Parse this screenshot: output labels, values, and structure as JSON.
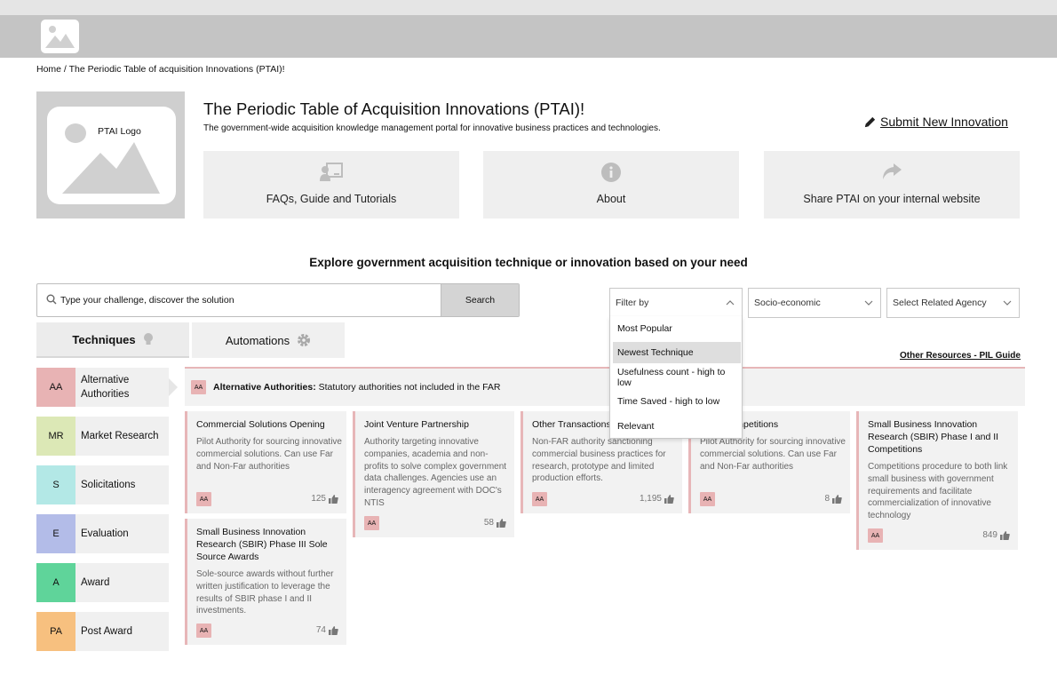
{
  "breadcrumb": "Home / The Periodic Table of acquisition Innovations (PTAI)!",
  "hero": {
    "logo_label": "PTAI Logo",
    "title": "The Periodic Table of Acquisition Innovations (PTAI)!",
    "subtitle": "The government-wide acquisition knowledge management portal for innovative business practices and technologies.",
    "submit_label": "Submit New Innovation"
  },
  "info_cards": [
    {
      "label": "FAQs, Guide and Tutorials",
      "icon": "tutorial-icon"
    },
    {
      "label": "About",
      "icon": "info-icon"
    },
    {
      "label": "Share PTAI on your internal website",
      "icon": "share-icon"
    }
  ],
  "explore_heading": "Explore government acquisition technique or innovation based on your need",
  "search": {
    "placeholder": "Type your challenge, discover the solution",
    "button": "Search"
  },
  "filters": {
    "filter_by": "Filter by",
    "socio": "Socio-economic",
    "agency": "Select Related Agency"
  },
  "filter_options": [
    "Most Popular",
    "Newest Technique",
    "Usefulness count - high to low",
    "Time Saved - high to low",
    "Relevant"
  ],
  "tabs": {
    "techniques": "Techniques",
    "automations": "Automations"
  },
  "other_resources": "Other Resources - PIL Guide",
  "categories": [
    {
      "symbol": "AA",
      "label": "Alternative Authorities",
      "color": "#e8b3b4"
    },
    {
      "symbol": "MR",
      "label": "Market Research",
      "color": "#dce8b6"
    },
    {
      "symbol": "S",
      "label": "Solicitations",
      "color": "#b3e8e6"
    },
    {
      "symbol": "E",
      "label": "Evaluation",
      "color": "#b3bce8"
    },
    {
      "symbol": "A",
      "label": "Award",
      "color": "#5fd49a"
    },
    {
      "symbol": "PA",
      "label": "Post Award",
      "color": "#f7c07f"
    }
  ],
  "selected": {
    "badge": "AA",
    "name": "Alternative Authorities:",
    "desc": "Statutory authorities not included in the FAR"
  },
  "cards": [
    {
      "title": "Commercial Solutions Opening",
      "desc": "Pilot Authority for sourcing innovative commercial solutions. Can use Far and Non-Far authorities",
      "badge": "AA",
      "likes": "125"
    },
    {
      "title": "Joint Venture Partnership",
      "desc": "Authority targeting innovative companies, academia and non-profits to solve complex government data challenges. Agencies use an interagency agreement with DOC's NTIS",
      "badge": "AA",
      "likes": "58"
    },
    {
      "title": "Other Transactions",
      "desc": "Non-FAR authority sanctioning commercial business practices for research, prototype and limited production efforts.",
      "badge": "AA",
      "likes": "1,195"
    },
    {
      "title": "Prize Competitions",
      "desc": "Pilot Authority for sourcing innovative commercial solutions. Can use Far and Non-Far authorities",
      "badge": "AA",
      "likes": "8"
    },
    {
      "title": "Small Business Innovation Research (SBIR) Phase I and II Competitions",
      "desc": "Competitions procedure to both link small business with government requirements and facilitate commercialization of innovative technology",
      "badge": "AA",
      "likes": "849"
    },
    {
      "title": "Small Business Innovation Research (SBIR) Phase III Sole Source Awards",
      "desc": "Sole-source awards without further written justification to leverage the results of SBIR phase I and II investments.",
      "badge": "AA",
      "likes": "74"
    }
  ]
}
